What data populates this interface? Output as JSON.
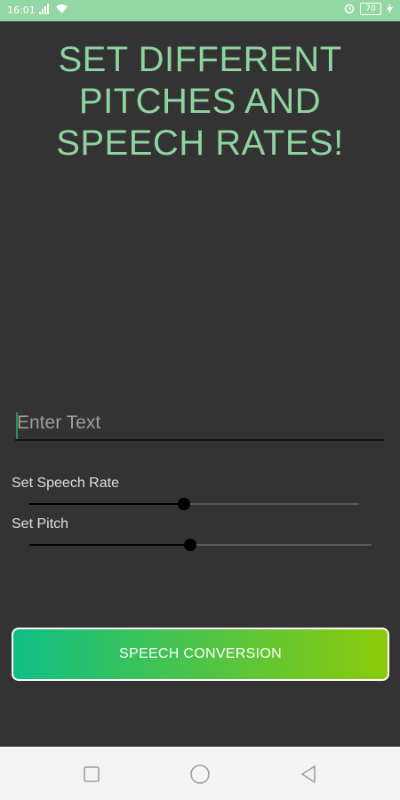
{
  "status_bar": {
    "time": "16:01",
    "battery_level": "70",
    "icons": [
      "signal-icon",
      "wifi-icon",
      "alarm-icon",
      "battery-icon",
      "charging-icon"
    ]
  },
  "title": {
    "lines": [
      "SET DIFFERENT",
      "PITCHES AND",
      "SPEECH RATES!"
    ],
    "color": "#8fd4a0"
  },
  "text_input": {
    "placeholder": "Enter Text",
    "value": ""
  },
  "speech_rate": {
    "label": "Set Speech Rate",
    "value_fraction": 0.47
  },
  "pitch": {
    "label": "Set Pitch",
    "value_fraction": 0.47
  },
  "convert_button": {
    "label": "SPEECH CONVERSION",
    "gradient_start": "#0fbe84",
    "gradient_end": "#8cca0a"
  },
  "nav_bar": {
    "icons": [
      "recents-square-icon",
      "home-circle-icon",
      "back-triangle-icon"
    ]
  },
  "colors": {
    "background": "#333333",
    "status_bar": "#93d8a4",
    "nav_bar": "#f4f4f4"
  }
}
